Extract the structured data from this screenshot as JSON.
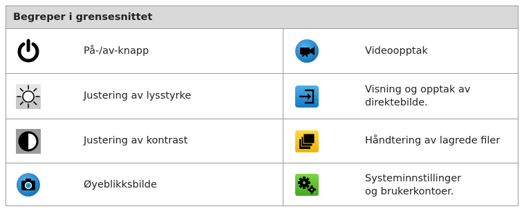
{
  "header": {
    "title": "Begreper i grensesnittet"
  },
  "rows": [
    {
      "left": {
        "icon": "power-icon",
        "label": "På-/av-knapp"
      },
      "right": {
        "icon": "video-recording-icon",
        "label": "Videoopptak"
      }
    },
    {
      "left": {
        "icon": "brightness-icon",
        "label": "Justering av lysstyrke"
      },
      "right": {
        "icon": "live-view-input-icon",
        "label": "Visning og opptak av\ndirektebilde."
      }
    },
    {
      "left": {
        "icon": "contrast-icon",
        "label": "Justering av kontrast"
      },
      "right": {
        "icon": "stored-files-icon",
        "label": "Håndtering av lagrede filer"
      }
    },
    {
      "left": {
        "icon": "camera-snapshot-icon",
        "label": "Øyeblikksbilde"
      },
      "right": {
        "icon": "settings-gears-icon",
        "label": "Systeminnstillinger\nog brukerkontoer."
      }
    }
  ],
  "colors": {
    "header_bg": "#d9d9d9",
    "border": "#9a9a9a",
    "blue_icon": "#1e8fd6",
    "yellow_icon": "#f4c20d",
    "green_icon": "#5cbf2a"
  }
}
